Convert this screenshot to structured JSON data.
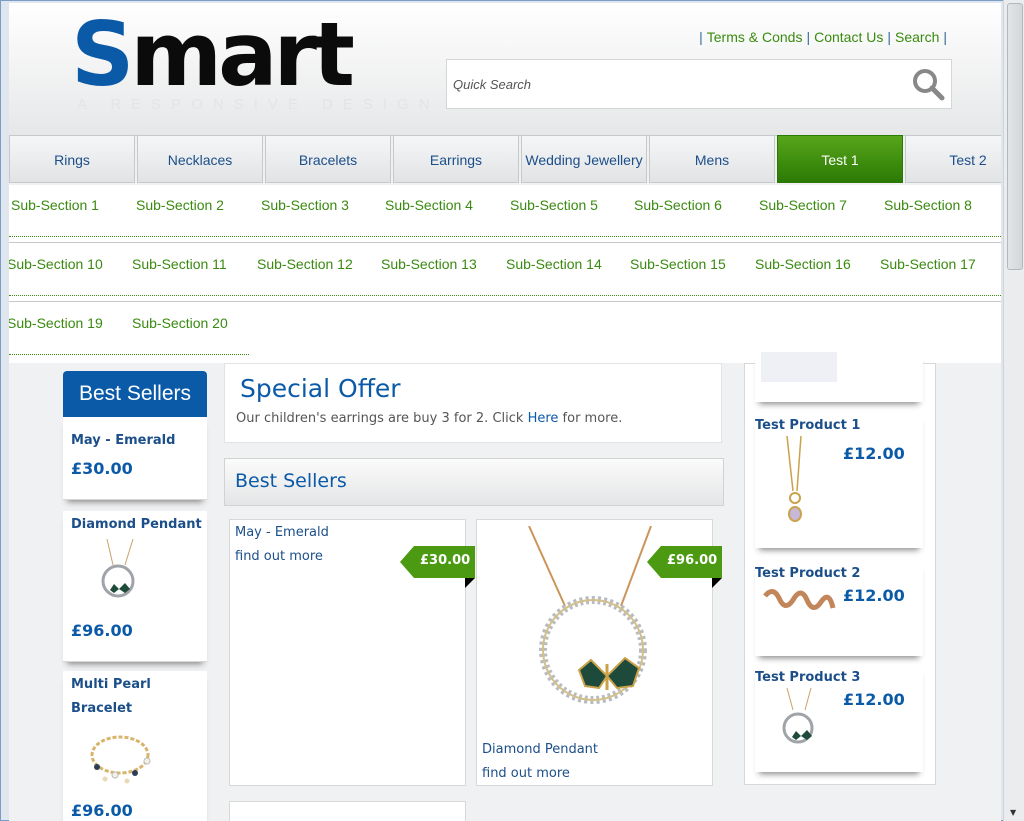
{
  "logo": {
    "s": "S",
    "rest": "mart",
    "tagline": "A RESPONSIVE DESIGN"
  },
  "toplinks": [
    "Terms & Conds",
    "Contact Us",
    "Search"
  ],
  "search": {
    "placeholder": "Quick Search",
    "icon": "search-icon"
  },
  "nav": [
    "Rings",
    "Necklaces",
    "Bracelets",
    "Earrings",
    "Wedding Jewellery",
    "Mens",
    "Test 1",
    "Test 2"
  ],
  "nav_active": "Test 1",
  "subnav": [
    [
      "Sub-Section 1",
      "Sub-Section 2",
      "Sub-Section 3",
      "Sub-Section 4",
      "Sub-Section 5",
      "Sub-Section 6",
      "Sub-Section 7",
      "Sub-Section 8"
    ],
    [
      "Sub-Section 10",
      "Sub-Section 11",
      "Sub-Section 12",
      "Sub-Section 13",
      "Sub-Section 14",
      "Sub-Section 15",
      "Sub-Section 16",
      "Sub-Section 17"
    ],
    [
      "Sub-Section 19",
      "Sub-Section 20"
    ]
  ],
  "left": {
    "title": "Best Sellers",
    "items": [
      {
        "name": "May - Emerald",
        "price": "£30.00"
      },
      {
        "name": "Diamond Pendant",
        "price": "£96.00"
      },
      {
        "name_line1": "Multi Pearl",
        "name_line2": "Bracelet",
        "price": "£96.00"
      }
    ]
  },
  "offer": {
    "title": "Special Offer",
    "text_before": "Our children's earrings are buy 3 for 2. Click ",
    "link": "Here",
    "text_after": " for more."
  },
  "bestsellers": {
    "title": "Best Sellers",
    "products": [
      {
        "name": "May - Emerald",
        "more": "find out more",
        "price": "£30.00"
      },
      {
        "name": "Diamond Pendant",
        "more": "find out more",
        "price": "£96.00"
      }
    ]
  },
  "right": {
    "items": [
      {
        "name": "Test Product 1",
        "price": "£12.00"
      },
      {
        "name": "Test Product 2",
        "price": "£12.00"
      },
      {
        "name": "Test Product 3",
        "price": "£12.00"
      }
    ]
  },
  "colors": {
    "brand_blue": "#0b5aa8",
    "accent_green": "#3a8a10",
    "active_nav": "#2c7a04"
  }
}
